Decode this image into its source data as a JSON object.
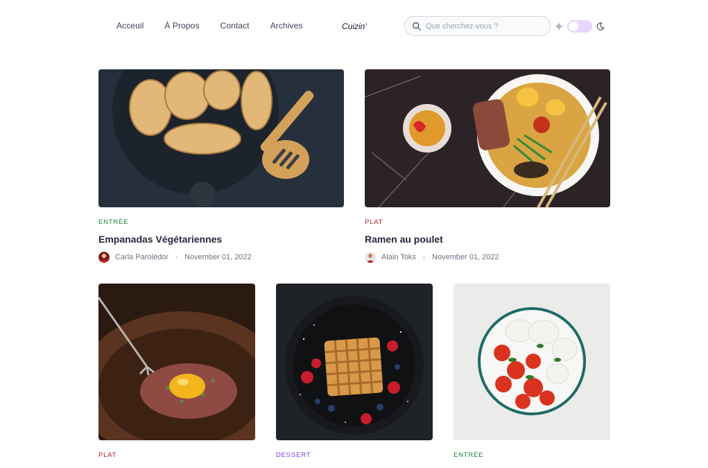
{
  "nav": {
    "items": [
      "Acceuil",
      "À Propos",
      "Contact",
      "Archives"
    ]
  },
  "brand": "Cuizin'",
  "search": {
    "placeholder": "Que cherchez-vous ?",
    "value": ""
  },
  "theme_toggle": {
    "state": "light",
    "accent": "#e9d5ff"
  },
  "icons": {
    "search": "search-icon",
    "sun": "sun-icon",
    "moon": "moon-icon"
  },
  "colors": {
    "entree": "#15803d",
    "plat": "#b91c1c",
    "dessert": "#7c3aed"
  },
  "cards": [
    {
      "category": "ENTRÉE",
      "title": "Empanadas Végétariennes",
      "author": "Carla Parolédor",
      "date": "November 01, 2022"
    },
    {
      "category": "PLAT",
      "title": "Ramen au poulet",
      "author": "Alain Toks",
      "date": "November 01, 2022"
    },
    {
      "category": "PLAT"
    },
    {
      "category": "DESSERT"
    },
    {
      "category": "ENTRÉE"
    }
  ]
}
